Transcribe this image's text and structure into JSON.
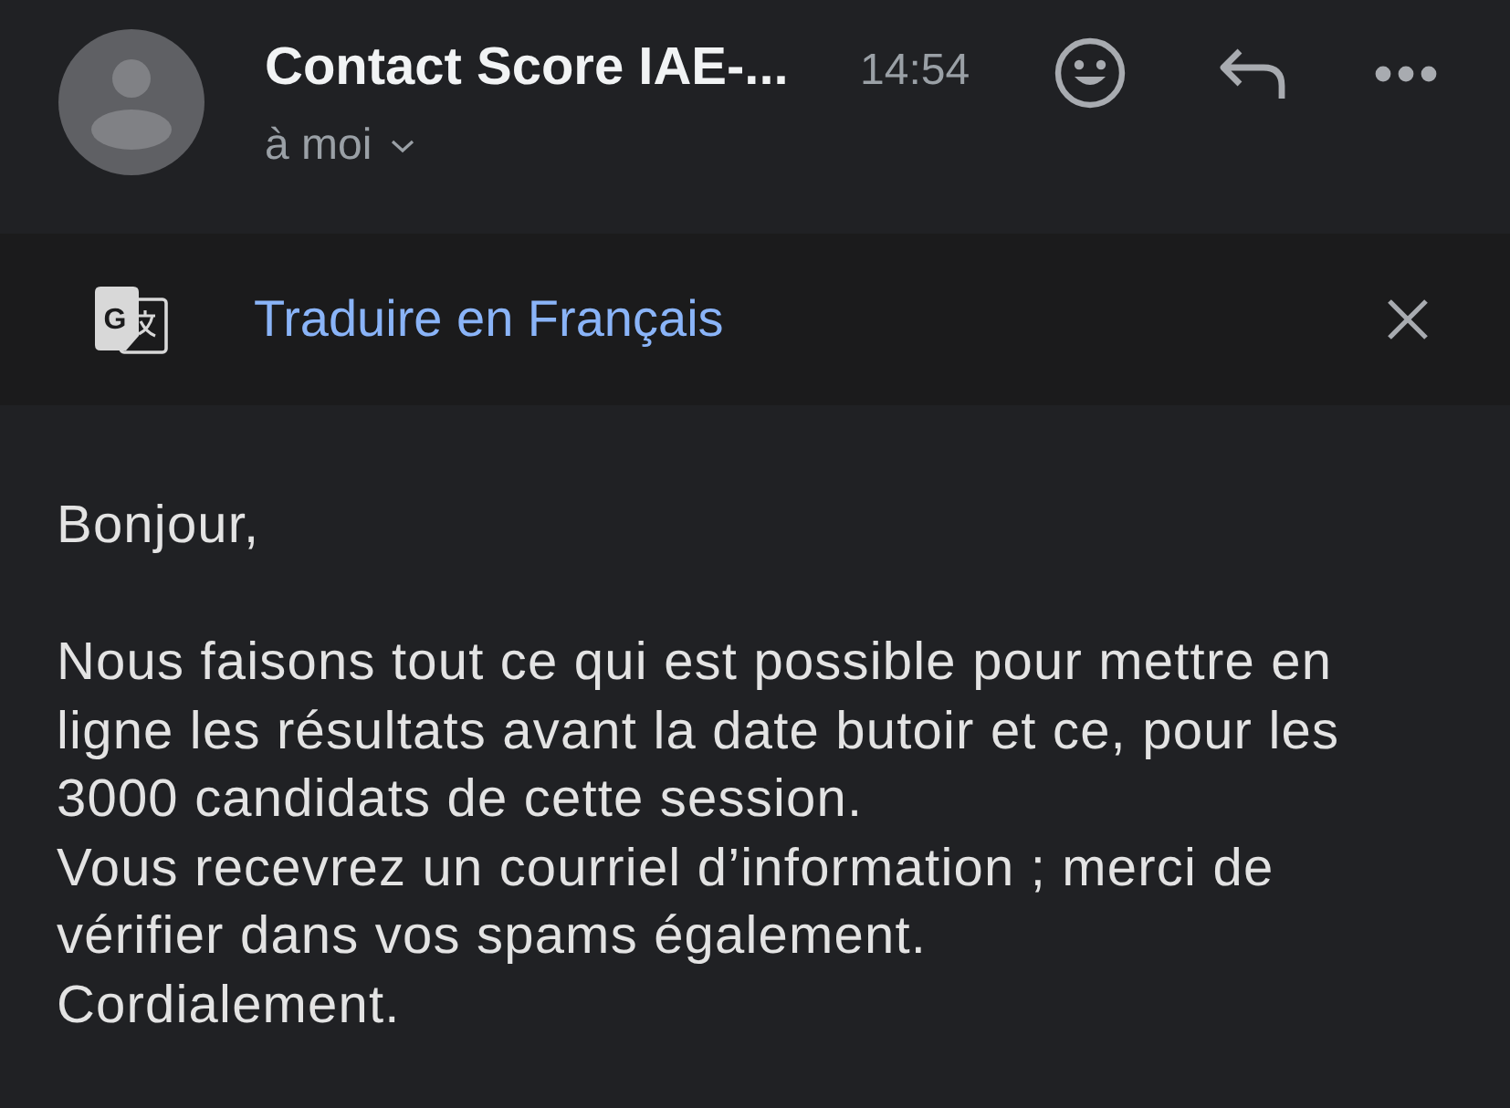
{
  "header": {
    "sender": "Contact Score IAE-...",
    "time": "14:54",
    "recipient": "à moi"
  },
  "translate_bar": {
    "icon_letter": "G",
    "label": "Traduire en Français"
  },
  "body": {
    "greeting": "Bonjour,",
    "paragraphs": [
      "Nous faisons tout ce qui est possible pour mettre en ligne les résultats avant la date butoir et ce, pour les 3000 candidats de cette session.",
      "Vous recevrez un courriel d’information ; merci de vérifier dans vos spams également.",
      "Cordialement."
    ]
  }
}
